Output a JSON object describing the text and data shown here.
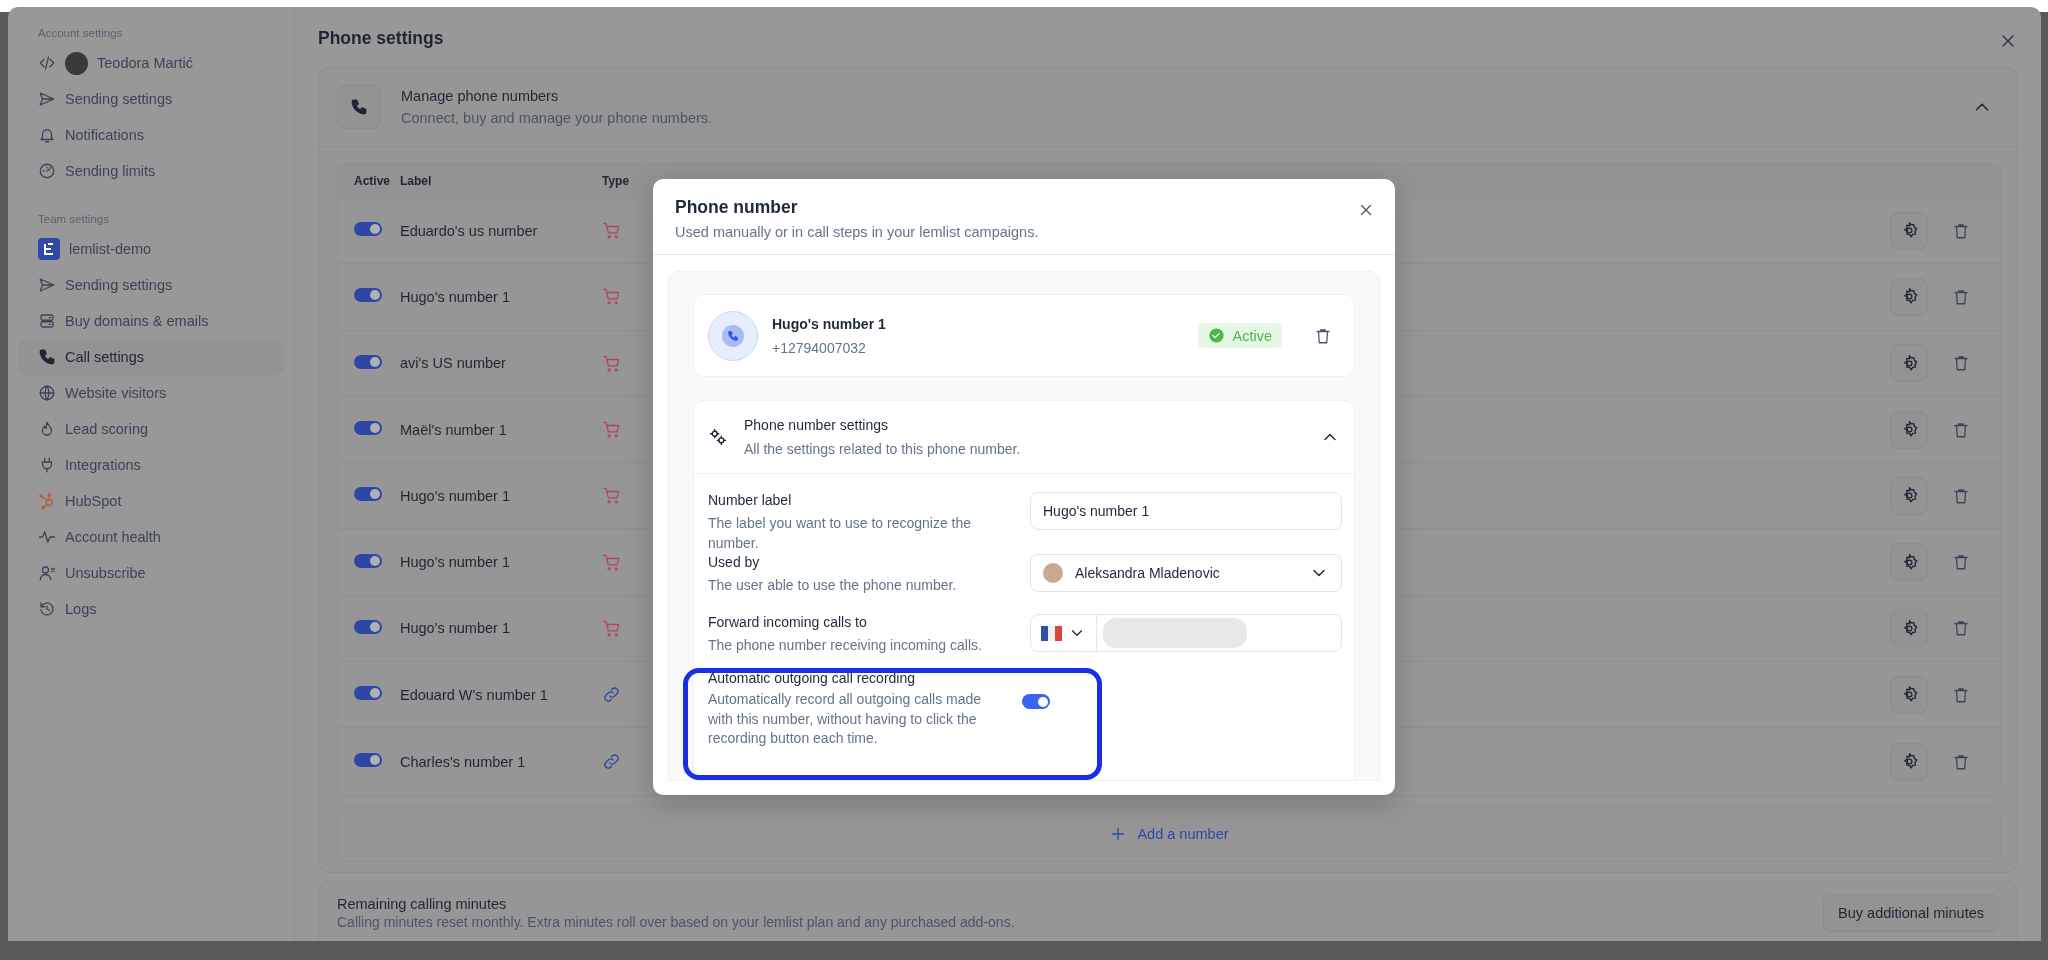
{
  "sidebar": {
    "sections": [
      {
        "heading": "Account settings",
        "items": [
          {
            "kind": "profile",
            "label": "Teodora Martić",
            "selected": false
          },
          {
            "kind": "link",
            "label": "Sending settings",
            "selected": false
          },
          {
            "kind": "link",
            "label": "Notifications",
            "selected": false
          },
          {
            "kind": "link",
            "label": "Sending limits",
            "selected": false
          }
        ]
      },
      {
        "heading": "Team settings",
        "items": [
          {
            "kind": "team",
            "label": "lemlist-demo",
            "selected": false
          },
          {
            "kind": "link",
            "label": "Sending settings",
            "selected": false
          },
          {
            "kind": "link",
            "label": "Buy domains & emails",
            "selected": false
          },
          {
            "kind": "link",
            "label": "Call settings",
            "selected": true
          },
          {
            "kind": "link",
            "label": "Website visitors",
            "selected": false
          },
          {
            "kind": "link",
            "label": "Lead scoring",
            "selected": false
          },
          {
            "kind": "link",
            "label": "Integrations",
            "selected": false
          },
          {
            "kind": "link",
            "label": "HubSpot",
            "selected": false
          },
          {
            "kind": "link",
            "label": "Account health",
            "selected": false
          },
          {
            "kind": "link",
            "label": "Unsubscribe",
            "selected": false
          },
          {
            "kind": "link",
            "label": "Logs",
            "selected": false
          }
        ]
      }
    ]
  },
  "page": {
    "title": "Phone settings"
  },
  "manage": {
    "title": "Manage phone numbers",
    "subtitle": "Connect, buy and manage your phone numbers.",
    "expanded": true,
    "table": {
      "columns": [
        "Active",
        "Label",
        "Type"
      ],
      "rows": [
        {
          "active": true,
          "label": "Eduardo's us number",
          "kind": "purchased"
        },
        {
          "active": true,
          "label": "Hugo's number 1",
          "kind": "purchased"
        },
        {
          "active": true,
          "label": "avi's US number",
          "kind": "purchased"
        },
        {
          "active": true,
          "label": "Maël's number 1",
          "kind": "purchased"
        },
        {
          "active": true,
          "label": "Hugo's number 1",
          "kind": "purchased"
        },
        {
          "active": true,
          "label": "Hugo's number 1",
          "kind": "purchased"
        },
        {
          "active": true,
          "label": "Hugo's number 1",
          "kind": "purchased"
        },
        {
          "active": true,
          "label": "Edouard W's number 1",
          "kind": "linked"
        },
        {
          "active": true,
          "label": "Charles's number 1",
          "kind": "linked"
        }
      ]
    },
    "add_button": "Add a number"
  },
  "minutes": {
    "title": "Remaining calling minutes",
    "subtitle": "Calling minutes reset monthly. Extra minutes roll over based on your lemlist plan and any purchased add-ons.",
    "button": "Buy additional minutes"
  },
  "modal": {
    "title": "Phone number",
    "subtitle": "Used manually or in call steps in your lemlist campaigns.",
    "number": {
      "name": "Hugo's number 1",
      "phone": "+12794007032",
      "status": "Active"
    },
    "settings": {
      "title": "Phone number settings",
      "subtitle": "All the settings related to this phone number.",
      "expanded": true
    },
    "fields": [
      {
        "kind": "text",
        "label": "Number label",
        "help": "The label you want to use to recognize the number.",
        "value": "Hugo's number 1"
      },
      {
        "kind": "select",
        "label": "Used by",
        "help": "The user able to use the phone number.",
        "value": "Aleksandra Mladenovic"
      },
      {
        "kind": "phone",
        "label": "Forward incoming calls to",
        "help": "The phone number receiving incoming calls."
      },
      {
        "kind": "toggle",
        "label": "Automatic outgoing call recording",
        "help": "Automatically record all outgoing calls made with this number, without having to click the recording button each time.",
        "on": true
      }
    ]
  }
}
